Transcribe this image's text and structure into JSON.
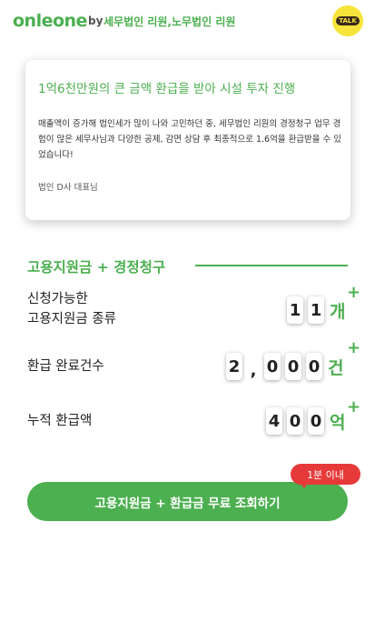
{
  "header": {
    "logo": "onleone",
    "by": "by",
    "firm": "세무법인 리원,노무법인 리원",
    "talk_label": "TALK"
  },
  "review": {
    "title": "1억6천만원의 큰 금액 환급을 받아 시설 투자 진행",
    "body": "매출액이 증가해 법인세가 많이 나와 고민하던 중, 세무법인 리원의 경정청구 업무 경험이 많은 세무사님과 다양한 공제, 감면 상담 후 최종적으로 1.6억을 환급받을 수 있었습니다!",
    "author": "법인 D사 대표님"
  },
  "stats": {
    "title": "고용지원금 + 경정청구",
    "rows": [
      {
        "label_line1": "신청가능한",
        "label_line2": "고용지원금 종류",
        "digits": [
          "1",
          "1"
        ],
        "unit": "개",
        "plus": "+"
      },
      {
        "label_line1": "환급 완료건수",
        "digits": [
          "2",
          ",",
          "0",
          "0",
          "0"
        ],
        "unit": "건",
        "plus": "+"
      },
      {
        "label_line1": "누적 환급액",
        "digits": [
          "4",
          "0",
          "0"
        ],
        "unit": "억",
        "plus": "+"
      }
    ]
  },
  "cta": {
    "label": "고용지원금 + 환급금 무료 조회하기",
    "badge": "1분 이내"
  },
  "colors": {
    "accent": "#4caf50",
    "badge": "#e63a3a",
    "kakao": "#f7e43a"
  }
}
